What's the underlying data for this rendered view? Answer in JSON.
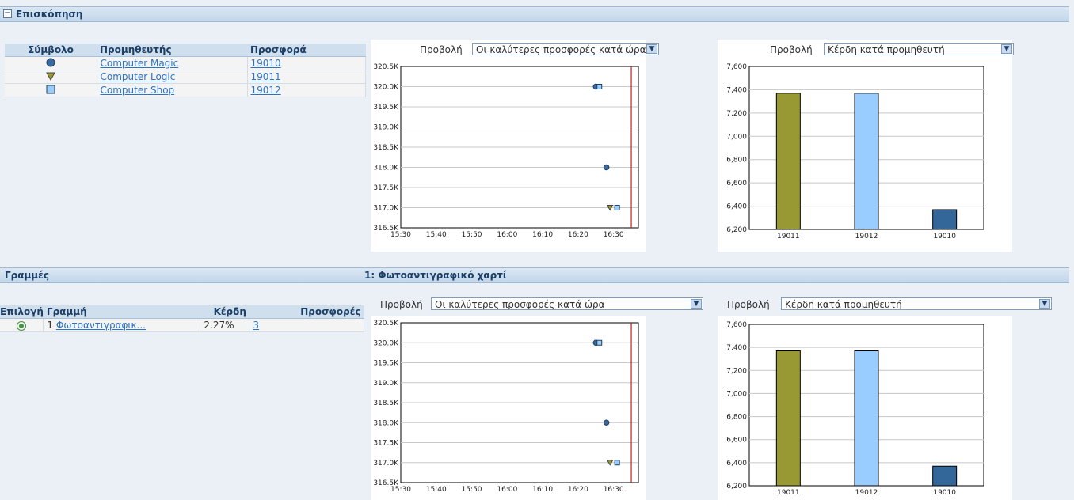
{
  "overview": {
    "title": "Επισκόπηση",
    "collapse_glyph": "−"
  },
  "supplier_table": {
    "headers": [
      "Σύμβολο",
      "Προμηθευτής",
      "Προσφορά"
    ],
    "rows": [
      {
        "symbol": "circle",
        "supplier": "Computer Magic",
        "offer": "19010"
      },
      {
        "symbol": "triangle",
        "supplier": "Computer Logic",
        "offer": "19011"
      },
      {
        "symbol": "square",
        "supplier": "Computer Shop",
        "offer": "19012"
      }
    ]
  },
  "view_label": "Προβολή",
  "top_left_select": "Οι καλύτερες προσφορές κατά ώρα",
  "top_right_select": "Κέρδη κατά προμηθευτή",
  "lines": {
    "title": "Γραμμές",
    "headers": [
      "Επιλογή",
      "Γραμμή",
      "Κέρδη",
      "Προσφορές"
    ],
    "row": {
      "num": "1",
      "line": "Φωτοαντιγραφικ...",
      "profit": "2.27%",
      "offers": "3"
    }
  },
  "detail": {
    "title": "1: Φωτοαντιγραφικό χαρτί",
    "left_select": "Οι καλύτερες προσφορές κατά ώρα",
    "right_select": "Κέρδη κατά προμηθευτή"
  },
  "colors": {
    "circle": "#3a6a9e",
    "triangle": "#9a9a30",
    "square": "#9dcdf5",
    "bar_19011": "#999933",
    "bar_19012": "#99ccff",
    "bar_19010": "#336699",
    "red_line": "#c02020"
  },
  "chart_data": [
    {
      "type": "scatter",
      "x_ticks": [
        "15:30",
        "15:40",
        "15:50",
        "16:00",
        "16:10",
        "16:20",
        "16:30"
      ],
      "y_ticks": [
        "320.5K",
        "320.0K",
        "319.5K",
        "319.0K",
        "318.5K",
        "318.0K",
        "317.5K",
        "317.0K",
        "316.5K"
      ],
      "ylim": [
        316500,
        320500
      ],
      "series": [
        {
          "name": "Computer Magic",
          "marker": "circle",
          "points": [
            [
              "16:25",
              320000
            ],
            [
              "16:28",
              318000
            ]
          ]
        },
        {
          "name": "Computer Logic",
          "marker": "triangle",
          "points": [
            [
              "16:29",
              317000
            ]
          ]
        },
        {
          "name": "Computer Shop",
          "marker": "square",
          "points": [
            [
              "16:26",
              320000
            ],
            [
              "16:31",
              317000
            ]
          ]
        }
      ],
      "reference_line_x": "16:35"
    },
    {
      "type": "bar",
      "categories": [
        "19011",
        "19012",
        "19010"
      ],
      "values": [
        7370,
        7370,
        6370
      ],
      "y_ticks": [
        "7,600",
        "7,400",
        "7,200",
        "7,000",
        "6,800",
        "6,600",
        "6,400",
        "6,200"
      ],
      "ylim": [
        6200,
        7600
      ]
    }
  ]
}
